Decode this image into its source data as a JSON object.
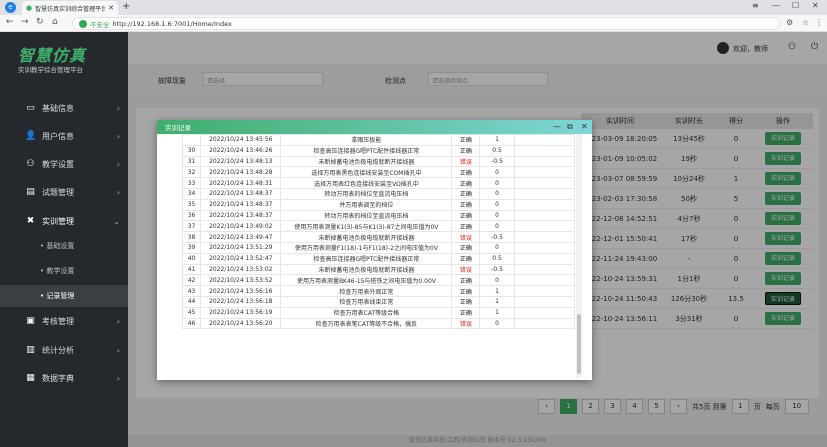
{
  "browser": {
    "tab_title": "智慧仿真实训综合管理平台",
    "url_label": "不安全",
    "url": "http://192.168.1.6:7001/Home/Index"
  },
  "brand": {
    "title": "智慧仿真",
    "subtitle": "实训教学综合管理平台"
  },
  "sidebar": {
    "items": [
      {
        "label": "基础信息"
      },
      {
        "label": "用户信息"
      },
      {
        "label": "教学设置"
      },
      {
        "label": "试题管理"
      },
      {
        "label": "实训管理"
      }
    ],
    "sub": [
      {
        "label": "基础设置"
      },
      {
        "label": "教学设置"
      },
      {
        "label": "记录管理"
      }
    ],
    "items2": [
      {
        "label": "考核管理"
      },
      {
        "label": "统计分析"
      },
      {
        "label": "数据字典"
      }
    ]
  },
  "topbar": {
    "welcome": "欢迎，教师"
  },
  "filter": {
    "label1": "故障现象",
    "placeholder1": "请选择",
    "label2": "检测点",
    "placeholder2": "请选择检测点"
  },
  "right_table": {
    "headers": [
      "实训时间",
      "实训时长",
      "得分",
      "操作"
    ],
    "rows": [
      {
        "time": "2023-03-09 18:20:05",
        "dur": "13分45秒",
        "score": "0",
        "btn": "实训记录"
      },
      {
        "time": "2023-01-09 10:05:02",
        "dur": "19秒",
        "score": "0",
        "btn": "实训记录"
      },
      {
        "time": "2023-03-07 08:59:59",
        "dur": "10分24秒",
        "score": "1",
        "btn": "实训记录"
      },
      {
        "time": "2023-02-03 17:30:58",
        "dur": "50秒",
        "score": "5",
        "btn": "实训记录"
      },
      {
        "time": "2022-12-08 14:52:51",
        "dur": "4分7秒",
        "score": "0",
        "btn": "实训记录"
      },
      {
        "time": "2022-12-01 15:50:41",
        "dur": "17秒",
        "score": "0",
        "btn": "实训记录"
      },
      {
        "time": "2022-11-24 19:43:00",
        "dur": "-",
        "score": "0",
        "btn": "实训记录"
      },
      {
        "time": "2022-10-24 13:59:31",
        "dur": "1分1秒",
        "score": "0",
        "btn": "实训记录"
      },
      {
        "time": "2022-10-24 11:50:43",
        "dur": "126分30秒",
        "score": "13.5",
        "btn": "实训记录"
      },
      {
        "time": "2022-10-24 13:56:11",
        "dur": "3分31秒",
        "score": "0",
        "btn": "实训记录"
      }
    ]
  },
  "pager": {
    "prev": "‹",
    "pages": [
      "1",
      "2",
      "3",
      "4",
      "5"
    ],
    "next": "›",
    "total": "共5页 到第",
    "page_input": "1",
    "page_unit": "页",
    "per_page": "每页",
    "per_page_value": "10"
  },
  "footer": "智慧仿真科技(江西)有限公司 版本号 V2.3.230209",
  "modal": {
    "title": "实训记录",
    "rows": [
      {
        "no": "",
        "time": "2022/10/24 13:45:56",
        "desc": "拿眼压板能",
        "status": "正确",
        "score": "1"
      },
      {
        "no": "30",
        "time": "2022/10/24 13:46:26",
        "desc": "检查高压连接器G嗯PTC配件接线器正常",
        "status": "正确",
        "score": "0.5"
      },
      {
        "no": "31",
        "time": "2022/10/24 13:48:13",
        "desc": "未断掉蓄电池负极电缆就断开接线器",
        "status": "错误",
        "score": "-0.5"
      },
      {
        "no": "32",
        "time": "2022/10/24 13:48:28",
        "desc": "选择万用表黑色连接线安装至COM插孔中",
        "status": "正确",
        "score": "0"
      },
      {
        "no": "33",
        "time": "2022/10/24 13:48:31",
        "desc": "选择万用表红色连接线安装至VΩ插孔中",
        "status": "正确",
        "score": "0"
      },
      {
        "no": "34",
        "time": "2022/10/24 13:48:37",
        "desc": "转动万用表的档位至直流电压档",
        "status": "正确",
        "score": "0"
      },
      {
        "no": "35",
        "time": "2022/10/24 13:48:37",
        "desc": "并万用表调至的档位",
        "status": "正确",
        "score": "0"
      },
      {
        "no": "36",
        "time": "2022/10/24 13:48:37",
        "desc": "转动万用表的档位至直流电压档",
        "status": "正确",
        "score": "0"
      },
      {
        "no": "37",
        "time": "2022/10/24 13:49:02",
        "desc": "使用万用表测量K1(3)-85与K1(3)-87之间电压值为0V",
        "status": "正确",
        "score": "0"
      },
      {
        "no": "38",
        "time": "2022/10/24 13:49:47",
        "desc": "未断掉蓄电池负极电缆就断开接线器",
        "status": "错误",
        "score": "-0.5"
      },
      {
        "no": "39",
        "time": "2022/10/24 13:51:29",
        "desc": "使用万用表测量F1(18)-1与F1(18)-2之间电压值为0V",
        "status": "正确",
        "score": "0"
      },
      {
        "no": "40",
        "time": "2022/10/24 13:52:47",
        "desc": "检查高压连接器G嗯PTC配件接线器正常",
        "status": "正确",
        "score": "0.5"
      },
      {
        "no": "41",
        "time": "2022/10/24 13:53:02",
        "desc": "未断掉蓄电池负极电缆就断开接线器",
        "status": "错误",
        "score": "-0.5"
      },
      {
        "no": "42",
        "time": "2022/10/24 13:53:52",
        "desc": "使用万用表测量BK46-15与搭铁之间电压值为0.00V",
        "status": "正确",
        "score": "0"
      },
      {
        "no": "43",
        "time": "2022/10/24 13:56:16",
        "desc": "检查万用表外观正常",
        "status": "正确",
        "score": "1"
      },
      {
        "no": "44",
        "time": "2022/10/24 13:56:18",
        "desc": "检查万用表线束正常",
        "status": "正确",
        "score": "1"
      },
      {
        "no": "45",
        "time": "2022/10/24 13:56:19",
        "desc": "检查万用表CAT等级合格",
        "status": "正确",
        "score": "1"
      },
      {
        "no": "46",
        "time": "2022/10/24 13:56:20",
        "desc": "检查万用表表笔CAT等级不合格，搞反",
        "status": "错误",
        "score": "0"
      }
    ]
  },
  "colors": {
    "accent": "#3fae6b",
    "error": "#e02020",
    "sidebar": "#25292d"
  }
}
